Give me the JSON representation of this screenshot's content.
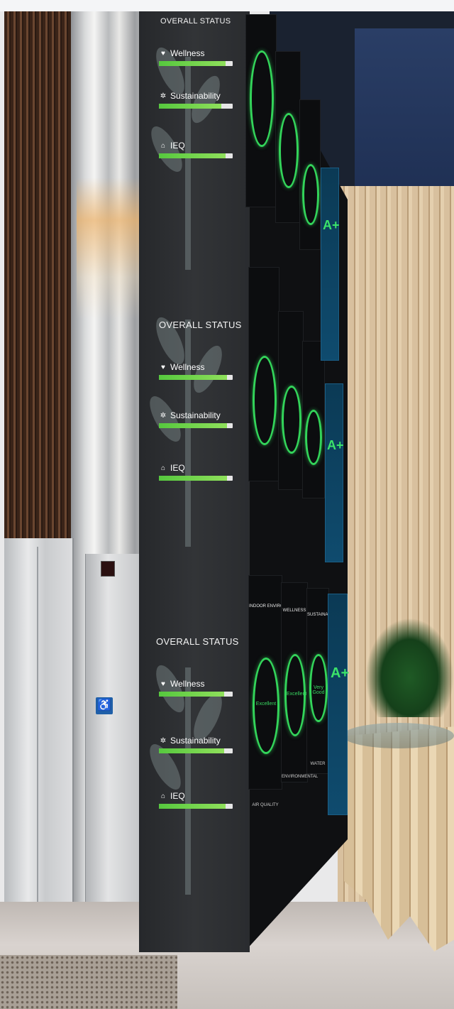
{
  "scene": {
    "description_none": ""
  },
  "status_panels": [
    {
      "title": "OVERALL STATUS",
      "metrics": [
        {
          "label": "Wellness",
          "icon": "heart-icon",
          "level": 0.9
        },
        {
          "label": "Sustainability",
          "icon": "sprout-icon",
          "level": 0.85
        },
        {
          "label": "IEQ",
          "icon": "home-icon",
          "level": 0.9
        }
      ]
    },
    {
      "title": "OVERALL STATUS",
      "metrics": [
        {
          "label": "Wellness",
          "icon": "heart-icon",
          "level": 0.92
        },
        {
          "label": "Sustainability",
          "icon": "sprout-icon",
          "level": 0.92
        },
        {
          "label": "IEQ",
          "icon": "home-icon",
          "level": 0.92
        }
      ]
    },
    {
      "title": "OVERALL STATUS",
      "metrics": [
        {
          "label": "Wellness",
          "icon": "heart-icon",
          "level": 0.88
        },
        {
          "label": "Sustainability",
          "icon": "sprout-icon",
          "level": 0.88
        },
        {
          "label": "IEQ",
          "icon": "home-icon",
          "level": 0.9
        }
      ]
    }
  ],
  "side_displays": {
    "ring_labels": [
      "Excellent",
      "Excellent",
      "Very Good"
    ],
    "headers": [
      "INDOOR ENVIRONMENTAL QUALITY",
      "WELLNESS",
      "SUSTAINABILITY"
    ],
    "footers": [
      "AIR QUALITY",
      "ENVIRONMENTAL",
      "WATER"
    ],
    "grade": "A+",
    "colors": {
      "ring": "#33d45a",
      "grade": "#3be36a",
      "accent_panel": "#0f4b6e"
    }
  }
}
